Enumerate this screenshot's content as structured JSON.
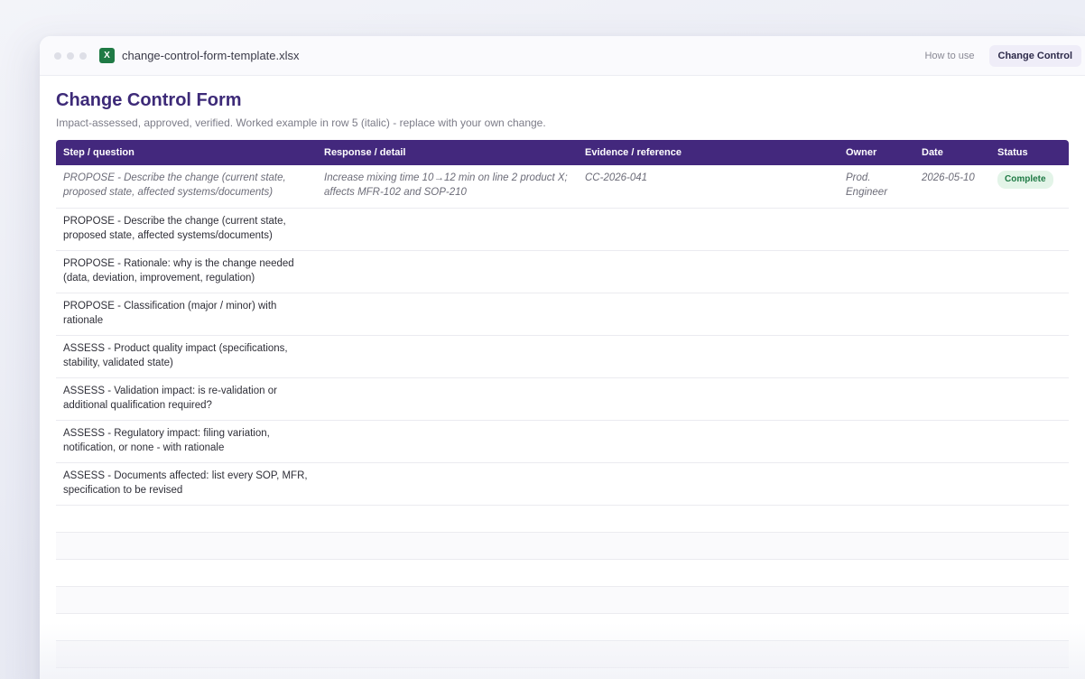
{
  "window": {
    "filename": "change-control-form-template.xlsx",
    "file_icon": "X",
    "tabs": [
      {
        "label": "How to use",
        "active": false
      },
      {
        "label": "Change Control",
        "active": true
      }
    ]
  },
  "sheet": {
    "title": "Change Control Form",
    "subtitle": "Impact-assessed, approved, verified. Worked example in row 5 (italic) - replace with your own change.",
    "columns": [
      "Step / question",
      "Response / detail",
      "Evidence / reference",
      "Owner",
      "Date",
      "Status"
    ],
    "rows": [
      {
        "step": "PROPOSE - Describe the change (current state, proposed state, affected systems/documents)",
        "response": "Increase mixing time 10→12 min on line 2 product X; affects MFR-102 and SOP-210",
        "evidence": "CC-2026-041",
        "owner": "Prod. Engineer",
        "date": "2026-05-10",
        "status": "Complete"
      },
      {
        "step": "PROPOSE - Describe the change (current state, proposed state, affected systems/documents)",
        "response": "",
        "evidence": "",
        "owner": "",
        "date": "",
        "status": ""
      },
      {
        "step": "PROPOSE - Rationale: why is the change needed (data, deviation, improvement, regulation)",
        "response": "",
        "evidence": "",
        "owner": "",
        "date": "",
        "status": ""
      },
      {
        "step": "PROPOSE - Classification (major / minor) with rationale",
        "response": "",
        "evidence": "",
        "owner": "",
        "date": "",
        "status": ""
      },
      {
        "step": "ASSESS - Product quality impact (specifications, stability, validated state)",
        "response": "",
        "evidence": "",
        "owner": "",
        "date": "",
        "status": ""
      },
      {
        "step": "ASSESS - Validation impact: is re-validation or additional qualification required?",
        "response": "",
        "evidence": "",
        "owner": "",
        "date": "",
        "status": ""
      },
      {
        "step": "ASSESS - Regulatory impact: filing variation, notification, or none - with rationale",
        "response": "",
        "evidence": "",
        "owner": "",
        "date": "",
        "status": ""
      },
      {
        "step": "ASSESS - Documents affected: list every SOP, MFR, specification to be revised",
        "response": "",
        "evidence": "",
        "owner": "",
        "date": "",
        "status": ""
      }
    ],
    "status_color": "#1f7a45",
    "header_color": "#43287d"
  }
}
